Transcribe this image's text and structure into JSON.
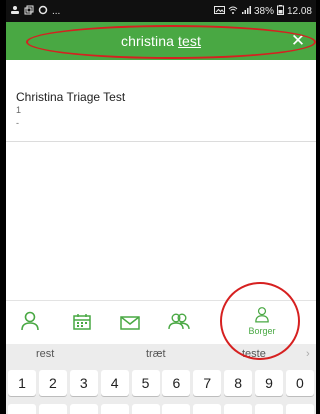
{
  "status_bar": {
    "left_icons": [
      "person-upload-icon",
      "copy-icon",
      "circle-icon"
    ],
    "left_ellipsis": "...",
    "battery_percent": "38%",
    "time": "12.08"
  },
  "search": {
    "query_prefix": "christina ",
    "query_underlined": "test",
    "close_icon": "close-icon"
  },
  "results": [
    {
      "name": "Christina Triage Test",
      "line1": "1",
      "line2": "-"
    }
  ],
  "tabbar": {
    "tabs": [
      {
        "icon": "person-outline-icon"
      },
      {
        "icon": "calendar-icon"
      },
      {
        "icon": "envelope-icon"
      },
      {
        "icon": "people-icon"
      },
      {
        "icon": "person-outline-icon",
        "label": "Borger"
      }
    ],
    "accent": "#49a843"
  },
  "keyboard": {
    "suggestions": [
      "rest",
      "træt",
      "teste"
    ],
    "number_keys": [
      "1",
      "2",
      "3",
      "4",
      "5",
      "6",
      "7",
      "8",
      "9",
      "0"
    ]
  },
  "colors": {
    "header_green": "#49a843",
    "annotation_red": "#d62020"
  }
}
